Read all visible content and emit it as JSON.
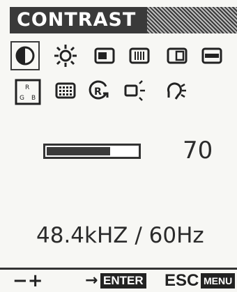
{
  "header": {
    "title": "CONTRAST"
  },
  "icons": [
    {
      "name": "contrast-icon",
      "selected": true
    },
    {
      "name": "brightness-icon"
    },
    {
      "name": "h-position-icon"
    },
    {
      "name": "h-size-icon"
    },
    {
      "name": "v-position-icon"
    },
    {
      "name": "v-size-icon"
    },
    {
      "name": "color-temperature-icon"
    },
    {
      "name": "moire-icon"
    },
    {
      "name": "recall-icon"
    },
    {
      "name": "degauss-icon"
    },
    {
      "name": "language-icon"
    }
  ],
  "slider": {
    "level_percent": 70
  },
  "value": "70",
  "frequency": "48.4kHZ / 60Hz",
  "footer": {
    "adjust_label": "−+",
    "arrow_label": "→",
    "enter_label": "ENTER",
    "esc_label": "ESC",
    "menu_label": "MENU"
  },
  "colors": {
    "osd_dark": "#3a3a3a",
    "background": "#f7f7f4"
  }
}
